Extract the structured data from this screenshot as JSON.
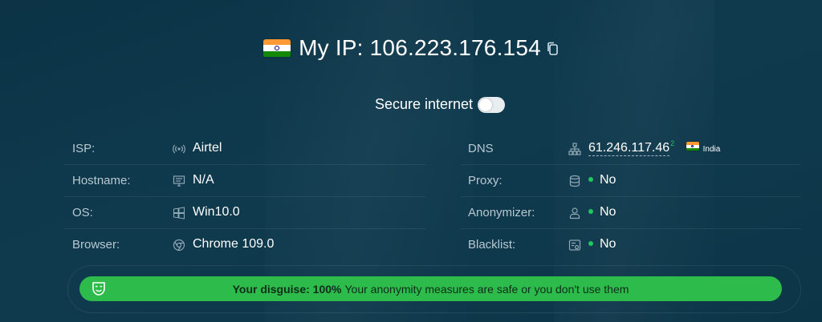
{
  "header": {
    "country_flag": "India",
    "ip_label": "My IP:",
    "ip_value": "106.223.176.154"
  },
  "secure_internet": {
    "label": "Secure internet",
    "enabled": false
  },
  "left_rows": [
    {
      "label": "ISP:",
      "icon": "wifi-signal-icon",
      "value": "Airtel"
    },
    {
      "label": "Hostname:",
      "icon": "server-icon",
      "value": "N/A"
    },
    {
      "label": "OS:",
      "icon": "windows-icon",
      "value": "Win10.0"
    },
    {
      "label": "Browser:",
      "icon": "chrome-icon",
      "value": "Chrome 109.0"
    }
  ],
  "right_rows": [
    {
      "label": "DNS",
      "icon": "network-tree-icon",
      "value": "61.246.117.46",
      "superscript": "2",
      "country": "India"
    },
    {
      "label": "Proxy:",
      "icon": "database-icon",
      "value": "No"
    },
    {
      "label": "Anonymizer:",
      "icon": "user-icon",
      "value": "No"
    },
    {
      "label": "Blacklist:",
      "icon": "blacklist-icon",
      "value": "No"
    }
  ],
  "disguise": {
    "bold_text": "Your disguise: 100%",
    "message": "Your anonymity measures are safe or you don't use them"
  },
  "colors": {
    "background": "#0f3a4e",
    "status_green": "#22c55e",
    "banner_green": "#2dbb4b"
  }
}
